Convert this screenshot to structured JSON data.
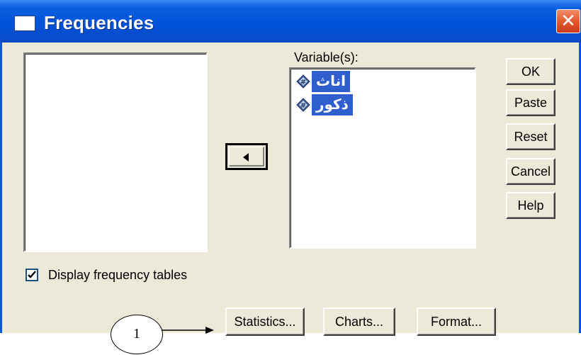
{
  "window": {
    "title": "Frequencies",
    "close_glyph": "✕",
    "colors": {
      "titlebar": "#0052d9",
      "face": "#ece9d8",
      "close": "#e35a2f",
      "selection": "#2f5fcf"
    }
  },
  "variables_panel": {
    "label": "Variable(s):",
    "items": [
      {
        "label": "اناث",
        "icon": "scale-variable-icon"
      },
      {
        "label": "ذكور",
        "icon": "scale-variable-icon"
      }
    ]
  },
  "move_button": {
    "icon": "left-arrow-icon"
  },
  "side_buttons": {
    "ok": "OK",
    "paste": "Paste",
    "reset": "Reset",
    "cancel": "Cancel",
    "help": "Help"
  },
  "checkbox": {
    "label": "Display frequency tables",
    "checked": true
  },
  "bottom_buttons": {
    "statistics": "Statistics...",
    "charts": "Charts...",
    "format": "Format..."
  },
  "annotation": {
    "number": "1"
  }
}
